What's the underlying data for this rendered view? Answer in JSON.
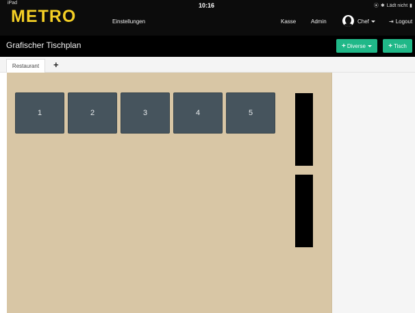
{
  "status_bar": {
    "device": "iPad",
    "time": "10:16",
    "charging_text": "Lädt nicht",
    "icons": [
      "location-icon",
      "bluetooth-icon",
      "battery-icon"
    ]
  },
  "header": {
    "logo": "METRO",
    "nav": {
      "settings": "Einstellungen",
      "kasse": "Kasse",
      "admin": "Admin",
      "user": "Chef",
      "logout": "Logout"
    }
  },
  "titlebar": {
    "title": "Grafischer Tischplan",
    "diverse_button": "Diverse",
    "tisch_button": "Tisch"
  },
  "tabs": {
    "items": [
      {
        "label": "Restaurant",
        "active": true
      }
    ],
    "add_label": "+"
  },
  "floor_plan": {
    "tables": [
      {
        "label": "1"
      },
      {
        "label": "2"
      },
      {
        "label": "3"
      },
      {
        "label": "4"
      },
      {
        "label": "5"
      }
    ]
  },
  "colors": {
    "logo": "#f4cf25",
    "accent_button": "#20b888",
    "floor": "#d8c6a5",
    "table": "#46545d",
    "header": "#0c0c0c"
  }
}
